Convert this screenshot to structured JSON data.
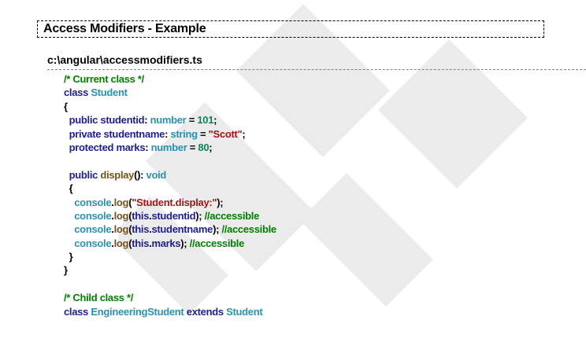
{
  "document": {
    "section_title": "Access Modifiers - Example",
    "file_path": "c:\\angular\\accessmodifiers.ts"
  },
  "code": {
    "lines": [
      [
        {
          "t": "/* Current class */",
          "c": "comment"
        }
      ],
      [
        {
          "t": "class",
          "c": "keyword"
        },
        {
          "t": " ",
          "c": "plain"
        },
        {
          "t": "Student",
          "c": "type"
        }
      ],
      [
        {
          "t": "{",
          "c": "plain"
        }
      ],
      [
        {
          "t": "  ",
          "c": "plain"
        },
        {
          "t": "public",
          "c": "keyword"
        },
        {
          "t": " studentid",
          "c": "keyword"
        },
        {
          "t": ": ",
          "c": "plain"
        },
        {
          "t": "number",
          "c": "type"
        },
        {
          "t": " = ",
          "c": "plain"
        },
        {
          "t": "101",
          "c": "number"
        },
        {
          "t": ";",
          "c": "plain"
        }
      ],
      [
        {
          "t": "  ",
          "c": "plain"
        },
        {
          "t": "private",
          "c": "keyword"
        },
        {
          "t": " studentname",
          "c": "keyword"
        },
        {
          "t": ": ",
          "c": "plain"
        },
        {
          "t": "string",
          "c": "type"
        },
        {
          "t": " = ",
          "c": "plain"
        },
        {
          "t": "\"Scott\"",
          "c": "string"
        },
        {
          "t": ";",
          "c": "plain"
        }
      ],
      [
        {
          "t": "  ",
          "c": "plain"
        },
        {
          "t": "protected",
          "c": "keyword"
        },
        {
          "t": " marks",
          "c": "keyword"
        },
        {
          "t": ": ",
          "c": "plain"
        },
        {
          "t": "number",
          "c": "type"
        },
        {
          "t": " = ",
          "c": "plain"
        },
        {
          "t": "80",
          "c": "number"
        },
        {
          "t": ";",
          "c": "plain"
        }
      ],
      [],
      [
        {
          "t": "  ",
          "c": "plain"
        },
        {
          "t": "public",
          "c": "keyword"
        },
        {
          "t": " ",
          "c": "plain"
        },
        {
          "t": "display",
          "c": "method"
        },
        {
          "t": "(): ",
          "c": "plain"
        },
        {
          "t": "void",
          "c": "type"
        }
      ],
      [
        {
          "t": "  {",
          "c": "plain"
        }
      ],
      [
        {
          "t": "    ",
          "c": "plain"
        },
        {
          "t": "console",
          "c": "type"
        },
        {
          "t": ".",
          "c": "plain"
        },
        {
          "t": "log",
          "c": "method"
        },
        {
          "t": "(",
          "c": "plain"
        },
        {
          "t": "\"Student.display:\"",
          "c": "string"
        },
        {
          "t": ");",
          "c": "plain"
        }
      ],
      [
        {
          "t": "    ",
          "c": "plain"
        },
        {
          "t": "console",
          "c": "type"
        },
        {
          "t": ".",
          "c": "plain"
        },
        {
          "t": "log",
          "c": "method"
        },
        {
          "t": "(",
          "c": "plain"
        },
        {
          "t": "this",
          "c": "keyword"
        },
        {
          "t": ".",
          "c": "plain"
        },
        {
          "t": "studentid",
          "c": "keyword"
        },
        {
          "t": "); ",
          "c": "plain"
        },
        {
          "t": "//accessible",
          "c": "comment"
        }
      ],
      [
        {
          "t": "    ",
          "c": "plain"
        },
        {
          "t": "console",
          "c": "type"
        },
        {
          "t": ".",
          "c": "plain"
        },
        {
          "t": "log",
          "c": "method"
        },
        {
          "t": "(",
          "c": "plain"
        },
        {
          "t": "this",
          "c": "keyword"
        },
        {
          "t": ".",
          "c": "plain"
        },
        {
          "t": "studentname",
          "c": "keyword"
        },
        {
          "t": "); ",
          "c": "plain"
        },
        {
          "t": "//accessible",
          "c": "comment"
        }
      ],
      [
        {
          "t": "    ",
          "c": "plain"
        },
        {
          "t": "console",
          "c": "type"
        },
        {
          "t": ".",
          "c": "plain"
        },
        {
          "t": "log",
          "c": "method"
        },
        {
          "t": "(",
          "c": "plain"
        },
        {
          "t": "this",
          "c": "keyword"
        },
        {
          "t": ".",
          "c": "plain"
        },
        {
          "t": "marks",
          "c": "keyword"
        },
        {
          "t": "); ",
          "c": "plain"
        },
        {
          "t": "//accessible",
          "c": "comment"
        }
      ],
      [
        {
          "t": "  }",
          "c": "plain"
        }
      ],
      [
        {
          "t": "}",
          "c": "plain"
        }
      ],
      [],
      [
        {
          "t": "/* Child class */",
          "c": "comment"
        }
      ],
      [
        {
          "t": "class",
          "c": "keyword"
        },
        {
          "t": " ",
          "c": "plain"
        },
        {
          "t": "EngineeringStudent",
          "c": "type"
        },
        {
          "t": " ",
          "c": "plain"
        },
        {
          "t": "extends",
          "c": "keyword"
        },
        {
          "t": " ",
          "c": "plain"
        },
        {
          "t": "Student",
          "c": "type"
        }
      ]
    ]
  },
  "colors": {
    "comment": "#008000",
    "keyword": "#1f1f8f",
    "type": "#2b91af",
    "string": "#a31515",
    "number": "#098658",
    "method": "#74531f",
    "watermark": "#e6e6e6"
  },
  "watermark": {
    "icon": "diagonal-watermark-letters"
  }
}
